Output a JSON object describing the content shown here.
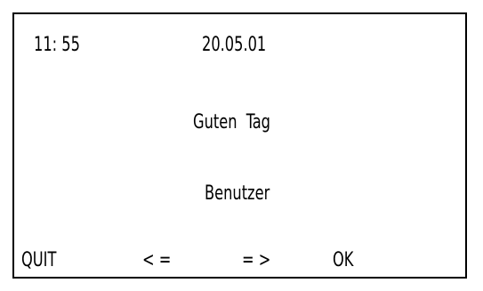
{
  "status_bar": {
    "time": "11: 55",
    "date": "20.05.01"
  },
  "message": {
    "greeting": "Guten  Tag",
    "user": "Benutzer"
  },
  "soft_keys": {
    "quit": "QUIT",
    "prev": "< =",
    "next": "= >",
    "ok": "OK"
  }
}
